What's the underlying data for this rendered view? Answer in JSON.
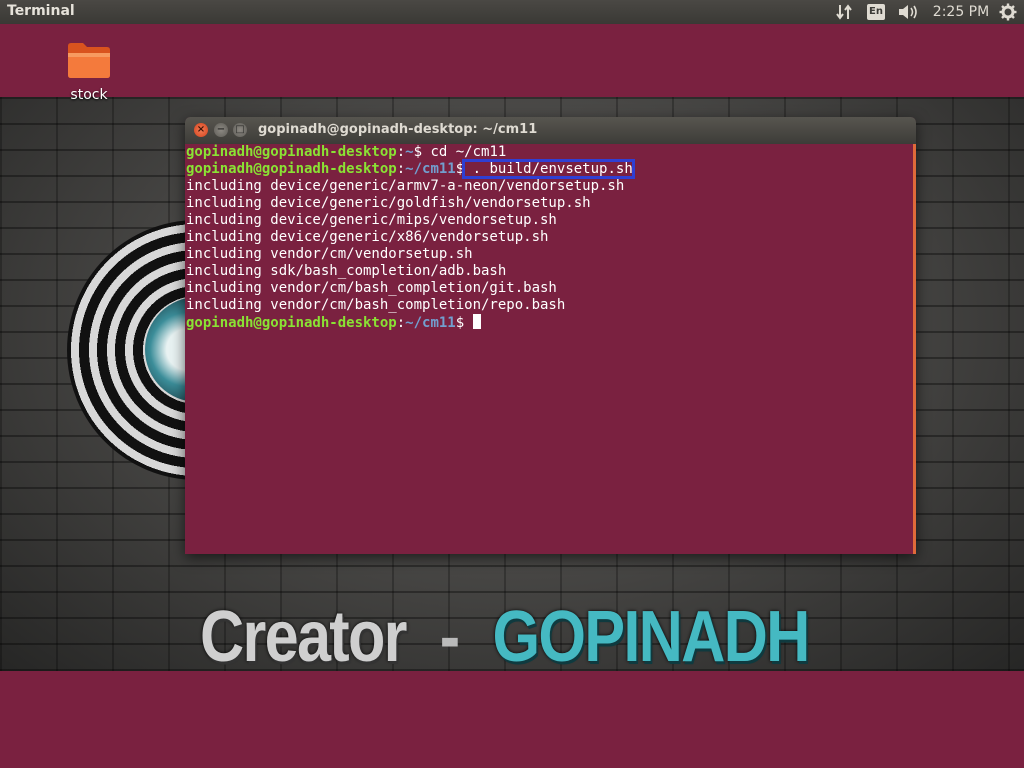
{
  "panel": {
    "app_title": "Terminal",
    "keyboard_layout": "En",
    "clock": "2:25 PM",
    "icons": [
      "network-icon",
      "keyboard-icon",
      "volume-icon",
      "system-gear-icon"
    ]
  },
  "desktop": {
    "folder_label": "stock",
    "wallpaper_text": {
      "creator": "Creator",
      "dash": "-",
      "name": "GOPINADH"
    }
  },
  "terminal": {
    "title": "gopinadh@gopinadh-desktop: ~/cm11",
    "buttons": {
      "close": "×",
      "minimize": "−",
      "maximize": "□"
    },
    "lines": [
      {
        "user": "gopinadh@gopinadh-desktop",
        "sep": ":",
        "path": "~",
        "sigil": "$ ",
        "cmd": "cd ~/cm11"
      },
      {
        "user": "gopinadh@gopinadh-desktop",
        "sep": ":",
        "path": "~/cm11",
        "sigil": "$",
        "cmd": " . build/envsetup.sh"
      },
      {
        "text": "including device/generic/armv7-a-neon/vendorsetup.sh"
      },
      {
        "text": "including device/generic/goldfish/vendorsetup.sh"
      },
      {
        "text": "including device/generic/mips/vendorsetup.sh"
      },
      {
        "text": "including device/generic/x86/vendorsetup.sh"
      },
      {
        "text": "including vendor/cm/vendorsetup.sh"
      },
      {
        "text": "including sdk/bash_completion/adb.bash"
      },
      {
        "text": "including vendor/cm/bash_completion/git.bash"
      },
      {
        "text": "including vendor/cm/bash_completion/repo.bash"
      },
      {
        "user": "gopinadh@gopinadh-desktop",
        "sep": ":",
        "path": "~/cm11",
        "sigil": "$ ",
        "cmd": ""
      }
    ]
  },
  "colors": {
    "terminal_bg": "#7a2140",
    "prompt_user": "#8ae234",
    "prompt_path": "#729fcf",
    "highlight_box": "#2f3fd4"
  }
}
